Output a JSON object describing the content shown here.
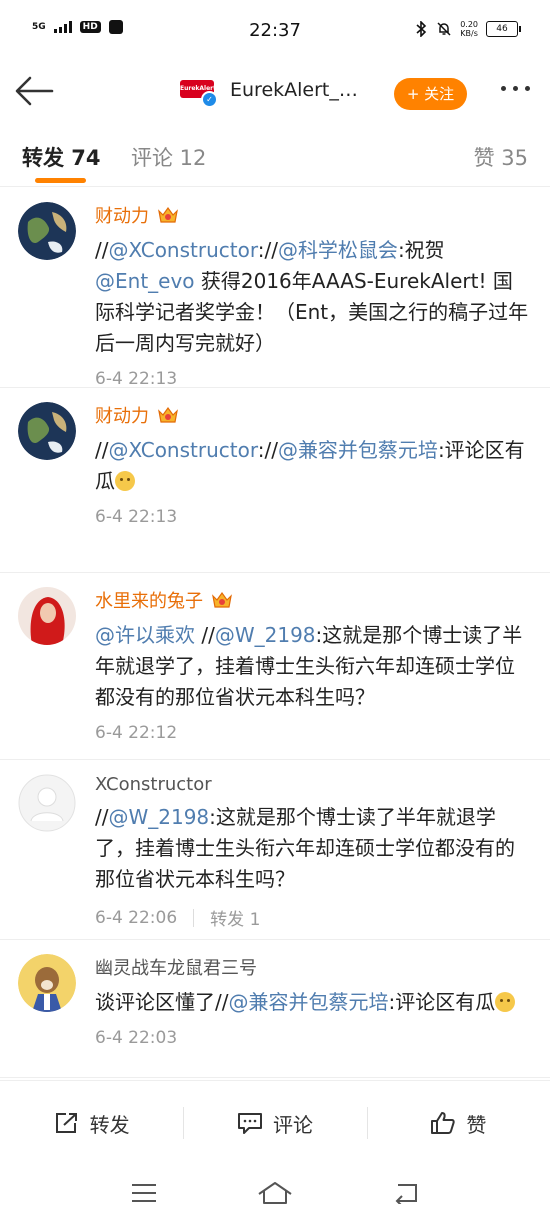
{
  "status": {
    "network": "5G",
    "hd": "HD",
    "time": "22:37",
    "speed_value": "0.20",
    "speed_unit": "KB/s",
    "battery": "46"
  },
  "nav": {
    "logo_text": "EurekAlert",
    "title": "EurekAlert_…",
    "follow_label": "+ 关注"
  },
  "tabs": {
    "repost": "转发 74",
    "comment": "评论 12",
    "like": "赞 35"
  },
  "items": [
    {
      "user": "财动力",
      "vip": true,
      "segments": [
        {
          "t": "//",
          "m": false
        },
        {
          "t": "@XConstructor",
          "m": true
        },
        {
          "t": "://",
          "m": false
        },
        {
          "t": "@科学松鼠会",
          "m": true
        },
        {
          "t": ":祝贺 ",
          "m": false
        },
        {
          "t": "@Ent_evo",
          "m": true
        },
        {
          "t": " 获得2016年AAAS-EurekAlert! 国际科学记者奖学金！（Ent，美国之行的稿子过年后一周内写完就好）",
          "m": false
        }
      ],
      "time": "6-4 22:13",
      "reposts": ""
    },
    {
      "user": "财动力",
      "vip": true,
      "segments": [
        {
          "t": "//",
          "m": false
        },
        {
          "t": "@XConstructor",
          "m": true
        },
        {
          "t": "://",
          "m": false
        },
        {
          "t": "@兼容并包蔡元培",
          "m": true
        },
        {
          "t": ":评论区有瓜",
          "m": false
        }
      ],
      "emoji": true,
      "time": "6-4 22:13",
      "reposts": ""
    },
    {
      "user": "水里来的兔子",
      "vip": true,
      "segments": [
        {
          "t": "@许以乘欢",
          "m": true
        },
        {
          "t": " //",
          "m": false
        },
        {
          "t": "@W_2198",
          "m": true
        },
        {
          "t": ":这就是那个博士读了半年就退学了，挂着博士生头衔六年却连硕士学位都没有的那位省状元本科生吗？",
          "m": false
        }
      ],
      "time": "6-4 22:12",
      "reposts": ""
    },
    {
      "user": "XConstructor",
      "vip": false,
      "segments": [
        {
          "t": "//",
          "m": false
        },
        {
          "t": "@W_2198",
          "m": true
        },
        {
          "t": ":这就是那个博士读了半年就退学了，挂着博士生头衔六年却连硕士学位都没有的那位省状元本科生吗？",
          "m": false
        }
      ],
      "time": "6-4 22:06",
      "reposts": "转发 1"
    },
    {
      "user": "幽灵战车龙鼠君三号",
      "vip": false,
      "segments": [
        {
          "t": "谈评论区懂了//",
          "m": false
        },
        {
          "t": "@兼容并包蔡元培",
          "m": true
        },
        {
          "t": ":评论区有瓜",
          "m": false
        }
      ],
      "emoji": true,
      "time": "6-4 22:03",
      "reposts": ""
    }
  ],
  "bottom": {
    "repost": "转发",
    "comment": "评论",
    "like": "赞"
  }
}
